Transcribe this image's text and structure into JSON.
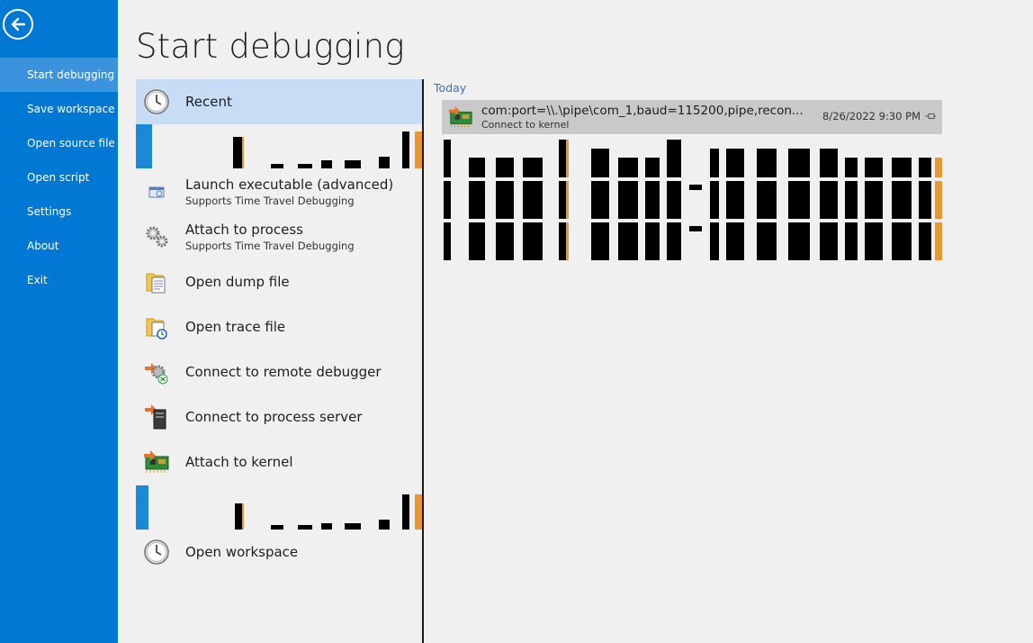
{
  "sidebar": {
    "back_icon": "back-arrow-icon",
    "items": [
      {
        "label": "Start debugging",
        "active": true
      },
      {
        "label": "Save workspace"
      },
      {
        "label": "Open source file"
      },
      {
        "label": "Open script"
      },
      {
        "label": "Settings"
      },
      {
        "label": "About"
      },
      {
        "label": "Exit"
      }
    ]
  },
  "page": {
    "title": "Start debugging"
  },
  "categories": [
    {
      "label": "Recent",
      "icon": "clock-icon"
    },
    {
      "label": "Launch executable (advanced)",
      "sub": "Supports Time Travel Debugging",
      "icon": "launch-executable-icon"
    },
    {
      "label": "Attach to process",
      "sub": "Supports Time Travel Debugging",
      "icon": "gears-icon"
    },
    {
      "label": "Open dump file",
      "icon": "dump-file-icon"
    },
    {
      "label": "Open trace file",
      "icon": "trace-file-icon"
    },
    {
      "label": "Connect to remote debugger",
      "icon": "remote-debugger-icon"
    },
    {
      "label": "Connect to process server",
      "icon": "process-server-icon"
    },
    {
      "label": "Attach to kernel",
      "icon": "kernel-board-icon"
    },
    {
      "label": "Open workspace",
      "icon": "clock-icon"
    }
  ],
  "recent": {
    "group": "Today",
    "entries": [
      {
        "title": "com:port=\\\\.\\pipe\\com_1,baud=115200,pipe,recon...",
        "sub": "Connect to kernel",
        "date": "8/26/2022 9:30 PM",
        "icon": "kernel-board-icon"
      }
    ]
  },
  "colors": {
    "sidebar": "#0078d4",
    "selected": "#c7dcf5",
    "group": "#3b6fb6"
  }
}
